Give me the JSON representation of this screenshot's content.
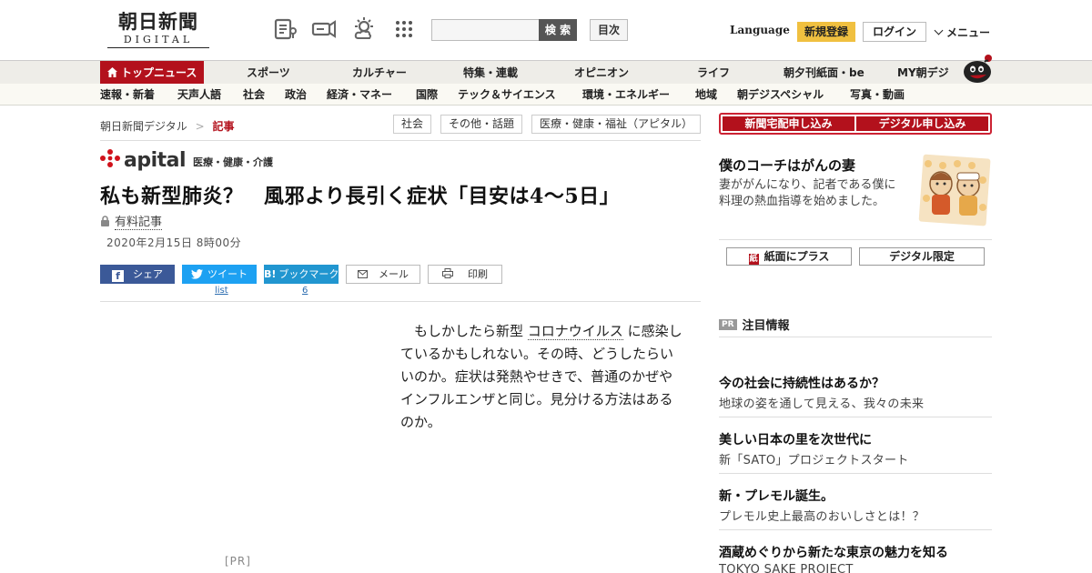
{
  "header": {
    "logo_main": "朝日新聞",
    "logo_sub": "DIGITAL",
    "search_button": "検 索",
    "toc_button": "目次",
    "language": "Language",
    "signup": "新規登録",
    "login": "ログイン",
    "menu": "メニュー",
    "icons": [
      "newspaper-icon",
      "megaphone-icon",
      "weather-icon",
      "grid-icon"
    ]
  },
  "nav_primary": [
    "トップニュース",
    "スポーツ",
    "カルチャー",
    "特集・連載",
    "オピニオン",
    "ライフ",
    "朝夕刊紙面・be",
    "MY朝デジ"
  ],
  "nav_secondary": [
    "速報・新着",
    "天声人語",
    "社会",
    "政治",
    "経済・マネー",
    "国際",
    "テック＆サイエンス",
    "環境・エネルギー",
    "地域",
    "朝デジスペシャル",
    "写真・動画"
  ],
  "breadcrumb": {
    "home": "朝日新聞デジタル",
    "separator": ">",
    "current": "記事"
  },
  "tags": [
    "社会",
    "その他・話題",
    "医療・健康・福祉（アピタル）"
  ],
  "article": {
    "brand": "apital",
    "brand_sub": "医療・健康・介護",
    "headline": "私も新型肺炎？　風邪より長引く症状「目安は4～5日」",
    "paid_label": "有料記事",
    "date": "2020年2月15日 8時00分",
    "lead_before": "もしかしたら新型",
    "lead_keyword": "コロナウイルス",
    "lead_after": "に感染しているかもしれない。その時、どうしたらいいのか。症状は発熱やせきで、普通のかぜやインフルエンザと同じ。見分ける方法はあるのか。",
    "pr_label": "[PR]"
  },
  "share": {
    "facebook": "シェア",
    "twitter": "ツイート",
    "twitter_count": "list",
    "hatena": "ブックマーク",
    "hatena_count": "6",
    "mail": "メール",
    "print": "印刷"
  },
  "sidebar": {
    "subscribe_paper": "新聞宅配申し込み",
    "subscribe_digital": "デジタル申し込み",
    "promo_title": "僕のコーチはがんの妻",
    "promo_text": "妻ががんになり、記者である僕に料理の熱血指導を始めました。",
    "btn_paper_plus": "紙面にプラス",
    "btn_digital_only": "デジタル限定",
    "pr_tag": "PR",
    "notice_title": "注目情報",
    "ads": [
      {
        "title": "今の社会に持続性はあるか？",
        "sub": "地球の姿を通して見える、我々の未来"
      },
      {
        "title": "美しい日本の里を次世代に",
        "sub": "新「SATO」プロジェクトスタート"
      },
      {
        "title": "新・プレモル誕生。",
        "sub": "プレモル史上最高のおいしさとは！？"
      },
      {
        "title": "酒蔵めぐりから新たな東京の魅力を知る",
        "sub": "TOKYO SAKE PROJECT"
      }
    ]
  },
  "colors": {
    "brand_red": "#b3111c",
    "signup_yellow": "#f0c040",
    "facebook": "#3b5998",
    "twitter": "#1da1f2",
    "hatena": "#2196d0"
  }
}
